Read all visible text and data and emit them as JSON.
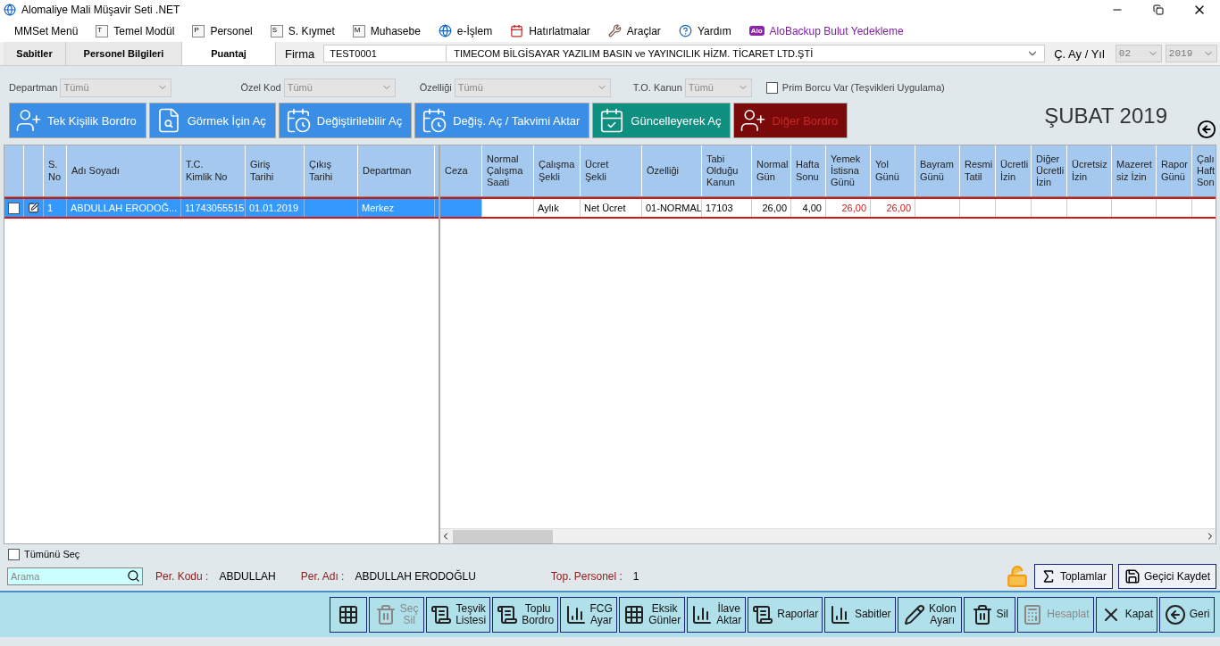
{
  "window": {
    "title": "Alomaliye Mali Müşavir Seti .NET"
  },
  "menu": [
    {
      "label": "MMSet Menü"
    },
    {
      "label": "Temel Modül",
      "letter": "T"
    },
    {
      "label": "Personel",
      "letter": "P"
    },
    {
      "label": "S. Kıymet",
      "letter": "S"
    },
    {
      "label": "Muhasebe",
      "letter": "M"
    },
    {
      "label": "e-İşlem"
    },
    {
      "label": "Hatırlatmalar"
    },
    {
      "label": "Araçlar"
    },
    {
      "label": "Yardım"
    },
    {
      "label": "AloBackup Bulut Yedekleme",
      "logo": "Alo"
    }
  ],
  "tabs": [
    {
      "label": "Sabitler",
      "selected": false
    },
    {
      "label": "Personel Bilgileri",
      "selected": false
    },
    {
      "label": "Puantaj",
      "selected": true
    }
  ],
  "firma": {
    "label": "Firma",
    "code": "TEST0001",
    "name": "TIMECOM BİLGİSAYAR YAZILIM BASIN ve YAYINCILIK HİZM. TİCARET LTD.ŞTİ"
  },
  "period": {
    "label": "Ç. Ay / Yıl",
    "month": "02",
    "year": "2019"
  },
  "filters": [
    {
      "label": "Departman",
      "value": "Tümü"
    },
    {
      "label": "Özel Kod",
      "value": "Tümü"
    },
    {
      "label": "Özelliği",
      "value": "Tümü"
    },
    {
      "label": "T.O. Kanun",
      "value": "Tümü"
    }
  ],
  "prim_borcu": {
    "label": "Prim Borcu Var (Teşvikleri Uygulama)",
    "checked": false
  },
  "actions": [
    {
      "label": "Tek Kişilik Bordro",
      "color": "#3a8ee6"
    },
    {
      "label": "Görmek İçin Aç",
      "color": "#3a8ee6"
    },
    {
      "label": "Değiştirilebilir Aç",
      "color": "#3a8ee6"
    },
    {
      "label": "Değiş. Aç / Takvimi Aktar",
      "color": "#3a8ee6"
    },
    {
      "label": "Güncelleyerek Aç",
      "color": "#0f8f80"
    },
    {
      "label": "Diğer Bordro",
      "color": "#7a0a0a"
    }
  ],
  "period_title": "ŞUBAT 2019",
  "left_table": {
    "columns": [
      "S.\nNo",
      "Adı Soyadı",
      "T.C.\nKimlik No",
      "Giriş\nTarihi",
      "Çıkış\nTarihi",
      "Departman"
    ],
    "rows": [
      {
        "selected": true,
        "checked": false,
        "cells": [
          "1",
          "ABDULLAH ERODOĞ...",
          "11743055515",
          "01.01.2019",
          null,
          "Merkez"
        ]
      }
    ]
  },
  "right_table": {
    "columns": [
      "Ceza",
      "Normal\nÇalışma\nSaati",
      "Çalışma\nŞekli",
      "Ücret\nŞekli",
      "Özelliği",
      "Tabi\nOlduğu\nKanun",
      "Normal\nGün",
      "Hafta\nSonu",
      "Yemek\nİstisna\nGünü",
      "Yol\nGünü",
      "Bayram\nGünü",
      "Resmi\nTatil",
      "Ücretli\nİzin",
      "Diğer\nÜcretli\nİzin",
      "Ücretsiz\nİzin",
      "Mazeret\nsiz İzin",
      "Rapor\nGünü",
      "Çalı\nHaft\nSon"
    ],
    "rows": [
      {
        "cells": [
          {
            "focused": true
          },
          {
            "focused": false
          },
          {
            "text": "Aylık",
            "focused": false,
            "flagged": false
          },
          {
            "text": "Net Ücret",
            "focused": false,
            "flagged": false
          },
          {
            "text": "01-NORMAL",
            "focused": false,
            "flagged": false
          },
          {
            "text": "17103",
            "focused": false,
            "flagged": false
          },
          {
            "text": "26,00",
            "focused": false,
            "flagged": false
          },
          {
            "text": "4,00",
            "focused": false,
            "flagged": false
          },
          {
            "text": "26,00",
            "focused": false,
            "flagged": true
          },
          {
            "text": "26,00",
            "focused": false,
            "flagged": true
          },
          {
            "focused": false
          },
          {
            "focused": false
          },
          {
            "focused": false
          },
          {
            "focused": false
          },
          {
            "focused": false
          },
          {
            "focused": false
          },
          {
            "focused": false
          }
        ]
      }
    ]
  },
  "select_all": {
    "label": "Tümünü Seç",
    "checked": false
  },
  "search": {
    "placeholder": "Arama"
  },
  "info": [
    {
      "label": "Per. Kodu :",
      "value": "ABDULLAH"
    },
    {
      "label": "Per. Adı :",
      "value": "ABDULLAH ERODOĞLU"
    },
    {
      "label": "Top. Personel :",
      "value": "1"
    }
  ],
  "side_buttons": [
    {
      "label": "Toplamlar"
    },
    {
      "label": "Geçici Kaydet"
    }
  ],
  "toolbar": [
    {
      "disabled": false
    },
    {
      "lines": [
        "Seç",
        "Sil"
      ],
      "disabled": true
    },
    {
      "lines": [
        "Teşvik",
        "Listesi"
      ],
      "disabled": false
    },
    {
      "lines": [
        "Toplu",
        "Bordro"
      ],
      "disabled": false
    },
    {
      "lines": [
        "FCG",
        "Ayar"
      ],
      "disabled": false
    },
    {
      "lines": [
        "Eksik",
        "Günler"
      ],
      "disabled": false
    },
    {
      "lines": [
        "İlave",
        "Aktar"
      ],
      "disabled": false
    },
    {
      "lines": [
        "Raporlar"
      ],
      "disabled": false
    },
    {
      "lines": [
        "Sabitler"
      ],
      "disabled": false
    },
    {
      "lines": [
        "Kolon",
        "Ayarı"
      ],
      "disabled": false
    },
    {
      "lines": [
        "Sil"
      ],
      "disabled": false
    },
    {
      "lines": [
        "Hesaplat"
      ],
      "disabled": true
    },
    {
      "lines": [
        "Kapat"
      ],
      "disabled": false
    },
    {
      "lines": [
        "Geri"
      ],
      "disabled": false
    }
  ]
}
